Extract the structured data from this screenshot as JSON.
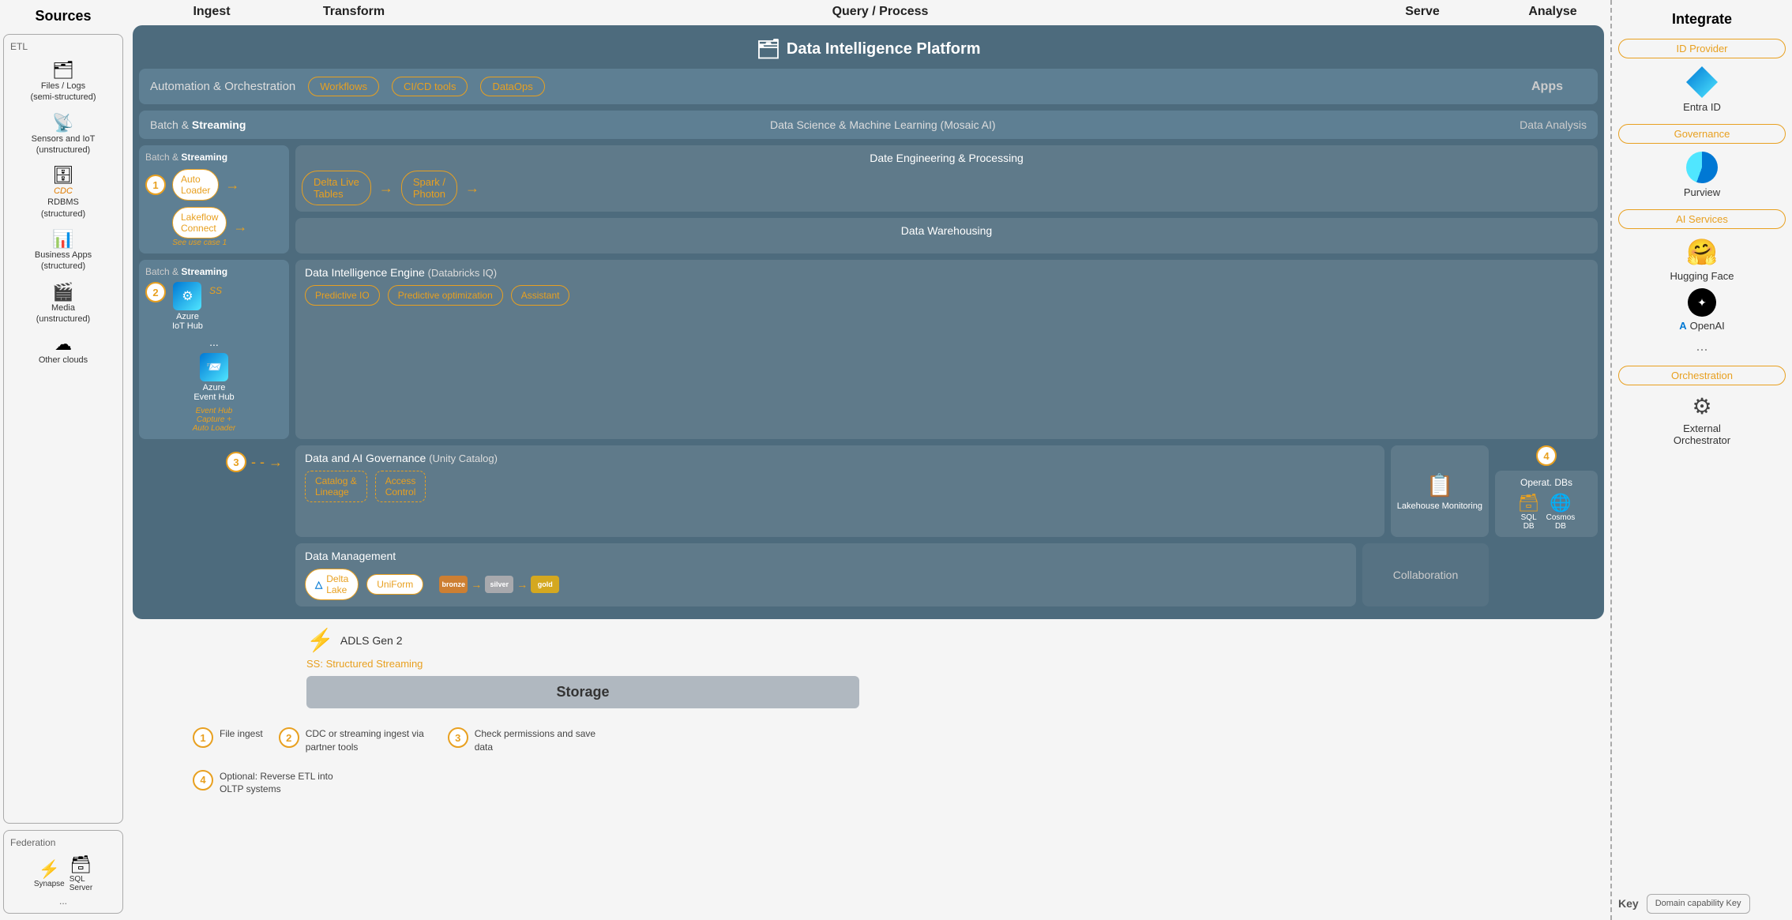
{
  "left_panel": {
    "title": "Sources",
    "etl_section": {
      "label": "ETL",
      "items": [
        {
          "icon": "🗂",
          "label": "Files / Logs\n(semi-structured)"
        },
        {
          "icon": "📡",
          "label": "Sensors and IoT\n(unstructured)"
        },
        {
          "icon": "🗄",
          "label": "RDBMS\n(structured)",
          "highlight": "CDC"
        },
        {
          "icon": "📊",
          "label": "Business Apps\n(structured)"
        },
        {
          "icon": "🎬",
          "label": "Media\n(unstructured)"
        },
        {
          "icon": "☁",
          "label": "Other clouds"
        }
      ]
    },
    "federation_section": {
      "label": "Federation",
      "items": [
        {
          "label": "Synapse  SQL\nServer"
        },
        {
          "label": "..."
        }
      ]
    }
  },
  "headers": {
    "ingest": "Ingest",
    "transform": "Transform",
    "query_process": "Query / Process",
    "serve": "Serve",
    "analyse": "Analyse"
  },
  "platform": {
    "title": "Data Intelligence Platform",
    "automation": {
      "label": "Automation & Orchestration",
      "badges": [
        "Workflows",
        "CI/CD tools",
        "DataOps"
      ]
    },
    "apps": "Apps",
    "dsml": {
      "label": "Batch & Streaming",
      "right_label": "Data Science & Machine Learning  (Mosaic AI)",
      "data_analysis_label": "Data Analysis"
    },
    "ingest_batch1": {
      "title_plain": "Batch & ",
      "title_bold": "Streaming",
      "items": [
        {
          "num": "1",
          "label": "Auto\nLoader"
        },
        {
          "num": "",
          "label": "Lakeflow\nConnect",
          "note": "See use case 1"
        }
      ]
    },
    "ingest_batch2": {
      "title_plain": "Batch & ",
      "title_bold": "Streaming",
      "items": [
        {
          "num": "2",
          "label": "Azure\nIoT Hub",
          "ss_label": "SS"
        },
        {
          "label": "..."
        },
        {
          "label": "Azure\nEvent Hub"
        }
      ],
      "note": "Event Hub\nCapture +\nAuto Loader"
    },
    "data_eng": {
      "title": "Date Engineering & Processing",
      "items": [
        "Delta Live\nTables",
        "Spark /\nPhoton"
      ]
    },
    "data_warehousing": "Data Warehousing",
    "engine": {
      "title": "Data Intelligence Engine",
      "subtitle": "(Databricks IQ)",
      "items": [
        "Predictive IO",
        "Predictive\noptimization",
        "Assistant"
      ]
    },
    "governance": {
      "title": "Data and AI Governance",
      "subtitle": "(Unity Catalog)",
      "items": [
        "Catalog &\nLineage",
        "Access\nControl"
      ],
      "monitoring": "Lakehouse\nMonitoring"
    },
    "operate_dbs": {
      "label": "Operat.\nDBs",
      "num": "4",
      "items": [
        "SQL\nDB",
        "Cosmos\nDB"
      ]
    },
    "data_management": {
      "title": "Data Management",
      "items": [
        "Delta\nLake",
        "UniForm"
      ],
      "medals": [
        "bronze",
        "silver",
        "gold"
      ]
    },
    "collaboration": "Collaboration"
  },
  "storage": {
    "adls_label": "ADLS Gen 2",
    "storage_label": "Storage",
    "ss_note": "SS: Structured Streaming"
  },
  "legend": {
    "items": [
      {
        "num": "1",
        "text": "File ingest"
      },
      {
        "num": "2",
        "text": "CDC or streaming ingest via partner tools"
      },
      {
        "num": "3",
        "text": "Check permissions and save data"
      },
      {
        "num": "4",
        "text": "Optional: Reverse ETL into OLTP systems"
      }
    ]
  },
  "integrate": {
    "title": "Integrate",
    "categories": [
      {
        "label": "ID Provider",
        "items": [
          {
            "icon": "entra",
            "label": "Entra ID"
          }
        ]
      },
      {
        "label": "Governance",
        "items": [
          {
            "icon": "purview",
            "label": "Purview"
          }
        ]
      },
      {
        "label": "AI Services",
        "items": [
          {
            "icon": "hf",
            "label": "Hugging Face"
          },
          {
            "icon": "openai",
            "label": "OpenAI"
          },
          {
            "icon": "dots",
            "label": "..."
          }
        ]
      },
      {
        "label": "Orchestration",
        "items": [
          {
            "icon": "ext",
            "label": "External\nOrchestrator"
          }
        ]
      }
    ],
    "key": {
      "label": "Key",
      "badge": "Domain\ncapability\nKey"
    }
  }
}
